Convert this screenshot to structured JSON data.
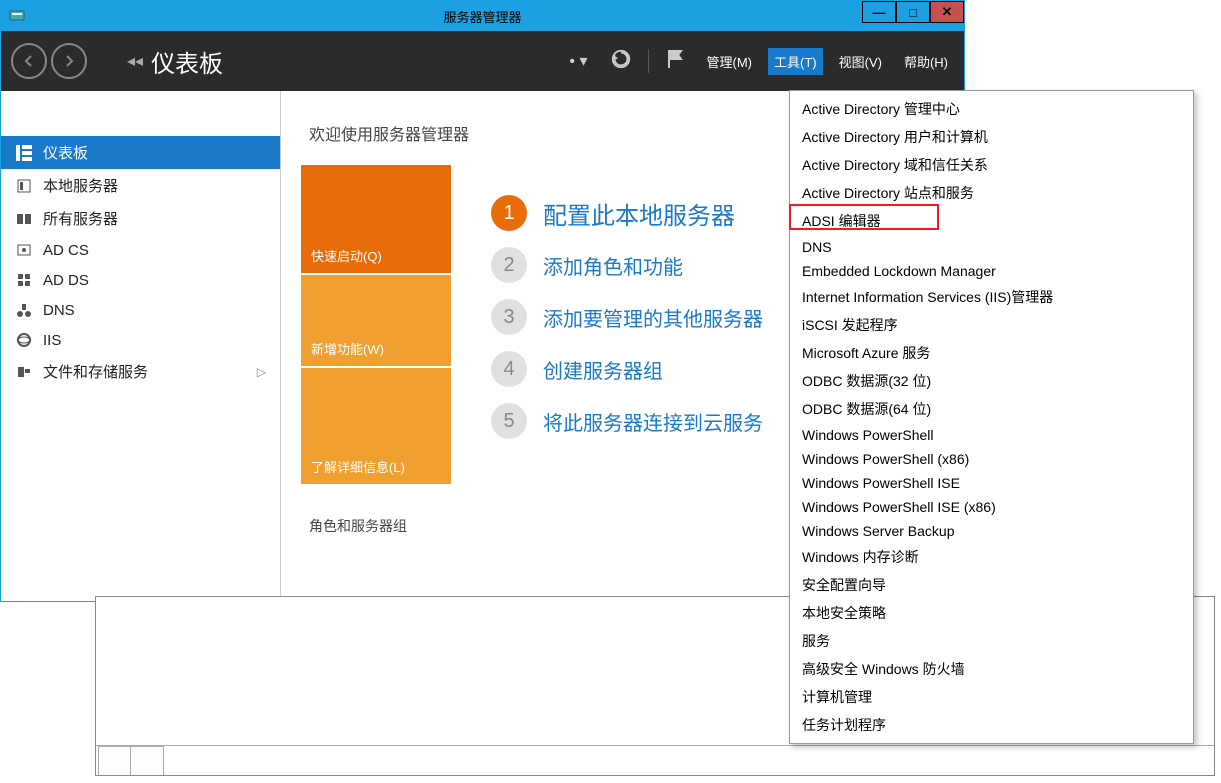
{
  "window": {
    "title": "服务器管理器"
  },
  "breadcrumb": {
    "label": "仪表板"
  },
  "menu": {
    "manage": "管理(M)",
    "tools": "工具(T)",
    "view": "视图(V)",
    "help": "帮助(H)"
  },
  "sidebar": {
    "items": [
      {
        "label": "仪表板"
      },
      {
        "label": "本地服务器"
      },
      {
        "label": "所有服务器"
      },
      {
        "label": "AD CS"
      },
      {
        "label": "AD DS"
      },
      {
        "label": "DNS"
      },
      {
        "label": "IIS"
      },
      {
        "label": "文件和存储服务"
      }
    ]
  },
  "main": {
    "welcome": "欢迎使用服务器管理器",
    "tiles": {
      "quick": "快速启动(Q)",
      "new": "新增功能(W)",
      "learn": "了解详细信息(L)"
    },
    "steps": [
      {
        "text": "配置此本地服务器"
      },
      {
        "text": "添加角色和功能"
      },
      {
        "text": "添加要管理的其他服务器"
      },
      {
        "text": "创建服务器组"
      },
      {
        "text": "将此服务器连接到云服务"
      }
    ],
    "roles_title": "角色和服务器组"
  },
  "tools_menu": {
    "items": [
      "Active Directory 管理中心",
      "Active Directory 用户和计算机",
      "Active Directory 域和信任关系",
      "Active Directory 站点和服务",
      "ADSI 编辑器",
      "DNS",
      "Embedded Lockdown Manager",
      "Internet Information Services (IIS)管理器",
      "iSCSI 发起程序",
      "Microsoft Azure 服务",
      "ODBC 数据源(32 位)",
      "ODBC 数据源(64 位)",
      "Windows PowerShell",
      "Windows PowerShell (x86)",
      "Windows PowerShell ISE",
      "Windows PowerShell ISE (x86)",
      "Windows Server Backup",
      "Windows 内存诊断",
      "安全配置向导",
      "本地安全策略",
      "服务",
      "高级安全 Windows 防火墙",
      "计算机管理",
      "任务计划程序"
    ]
  }
}
